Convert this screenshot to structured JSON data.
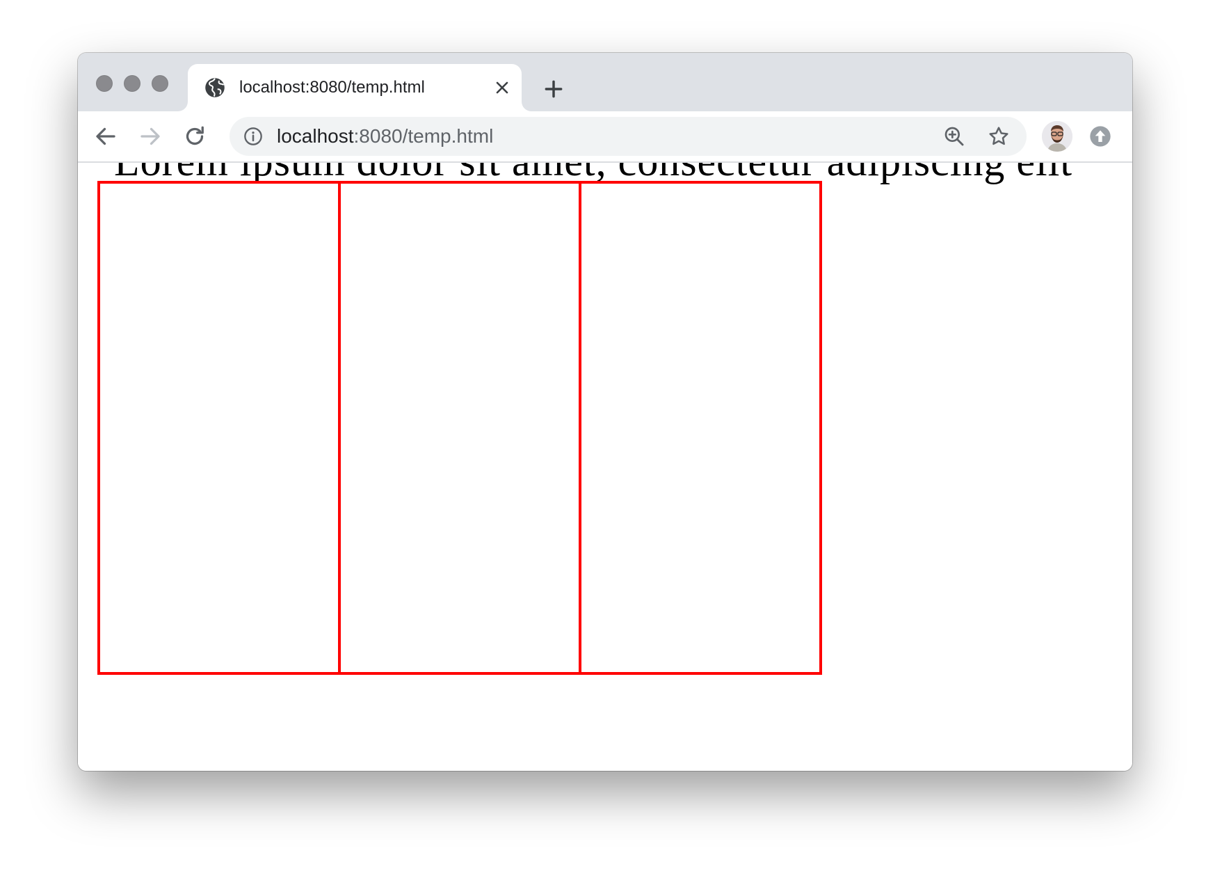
{
  "browser": {
    "tab": {
      "title": "localhost:8080/temp.html",
      "favicon": "globe-icon",
      "close_icon": "close-icon"
    },
    "new_tab_icon": "plus-icon",
    "toolbar": {
      "back_icon": "arrow-left-icon",
      "forward_icon": "arrow-right-icon",
      "reload_icon": "reload-icon",
      "site_info_icon": "info-icon",
      "url_host": "localhost",
      "url_path": ":8080/temp.html",
      "zoom_icon": "zoom-in-icon",
      "bookmark_icon": "star-icon",
      "profile_avatar": "avatar",
      "update_icon": "update-arrow-icon"
    },
    "colors": {
      "tabstrip": "#dee1e6",
      "omnibox": "#f1f3f4",
      "traffic_light": "#8a8a8e"
    }
  },
  "page": {
    "cut_off_text": "Lorem ipsum dolor sit amet, consectetur adipiscing elit",
    "columns": [
      {
        "id": "column-1"
      },
      {
        "id": "column-2"
      },
      {
        "id": "column-3"
      }
    ],
    "column_border_color": "#ff0000"
  }
}
